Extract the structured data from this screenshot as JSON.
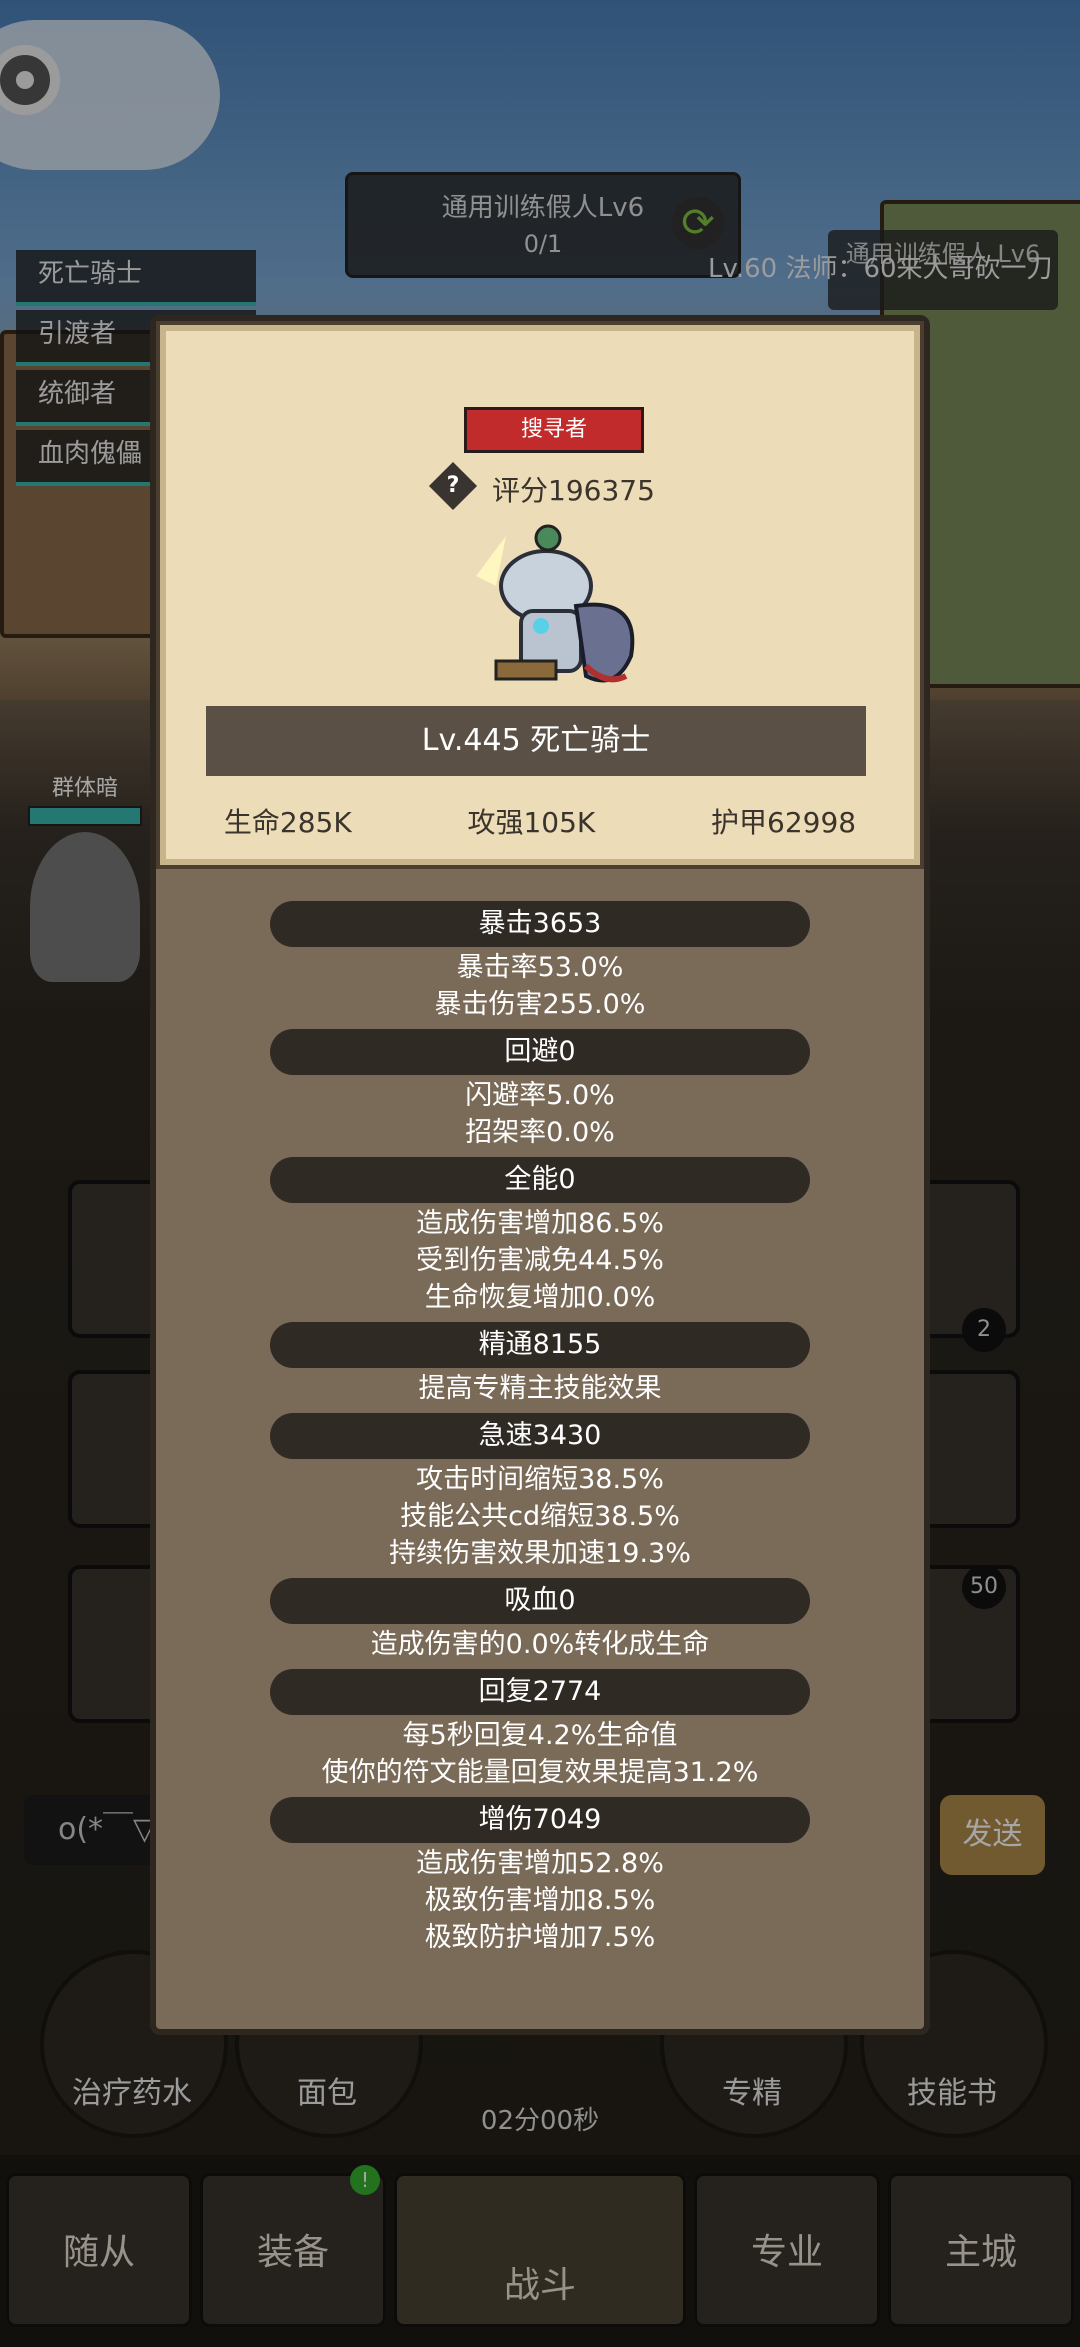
{
  "background": {
    "top_task": {
      "title": "通用训练假人Lv6",
      "progress": "0/1"
    },
    "player_info": "Lv.60 法师：60来大哥砍一刀",
    "right_box": "通用训练假人 Lv6",
    "party": [
      "死亡骑士",
      "引渡者",
      "统御者",
      "血肉傀儡"
    ],
    "side_unit": {
      "name": "群体暗"
    },
    "badges": [
      "2",
      "50"
    ],
    "chat_input": "o(*￣▽",
    "send_button": "发送",
    "items": [
      "治疗药水",
      "面包",
      "专精",
      "技能书"
    ],
    "timer": "02分00秒",
    "nav": [
      "随从",
      "装备",
      "战斗",
      "专业",
      "主城"
    ],
    "nav_notification": "!"
  },
  "popup": {
    "class_tag": "搜寻者",
    "score": "评分196375",
    "name_banner": "Lv.445 死亡骑士",
    "stats": [
      "生命285K",
      "攻强105K",
      "护甲62998"
    ],
    "sections": [
      {
        "head": "暴击3653",
        "lines": [
          "暴击率53.0%",
          "暴击伤害255.0%"
        ]
      },
      {
        "head": "回避0",
        "lines": [
          "闪避率5.0%",
          "招架率0.0%"
        ]
      },
      {
        "head": "全能0",
        "lines": [
          "造成伤害增加86.5%",
          "受到伤害减免44.5%",
          "生命恢复增加0.0%"
        ]
      },
      {
        "head": "精通8155",
        "lines": [
          "提高专精主技能效果"
        ]
      },
      {
        "head": "急速3430",
        "lines": [
          "攻击时间缩短38.5%",
          "技能公共cd缩短38.5%",
          "持续伤害效果加速19.3%"
        ]
      },
      {
        "head": "吸血0",
        "lines": [
          "造成伤害的0.0%转化成生命"
        ]
      },
      {
        "head": "回复2774",
        "lines": [
          "每5秒回复4.2%生命值",
          "使你的符文能量回复效果提高31.2%"
        ]
      },
      {
        "head": "增伤7049",
        "lines": [
          "造成伤害增加52.8%",
          "极致伤害增加8.5%",
          "极致防护增加7.5%"
        ]
      }
    ]
  }
}
